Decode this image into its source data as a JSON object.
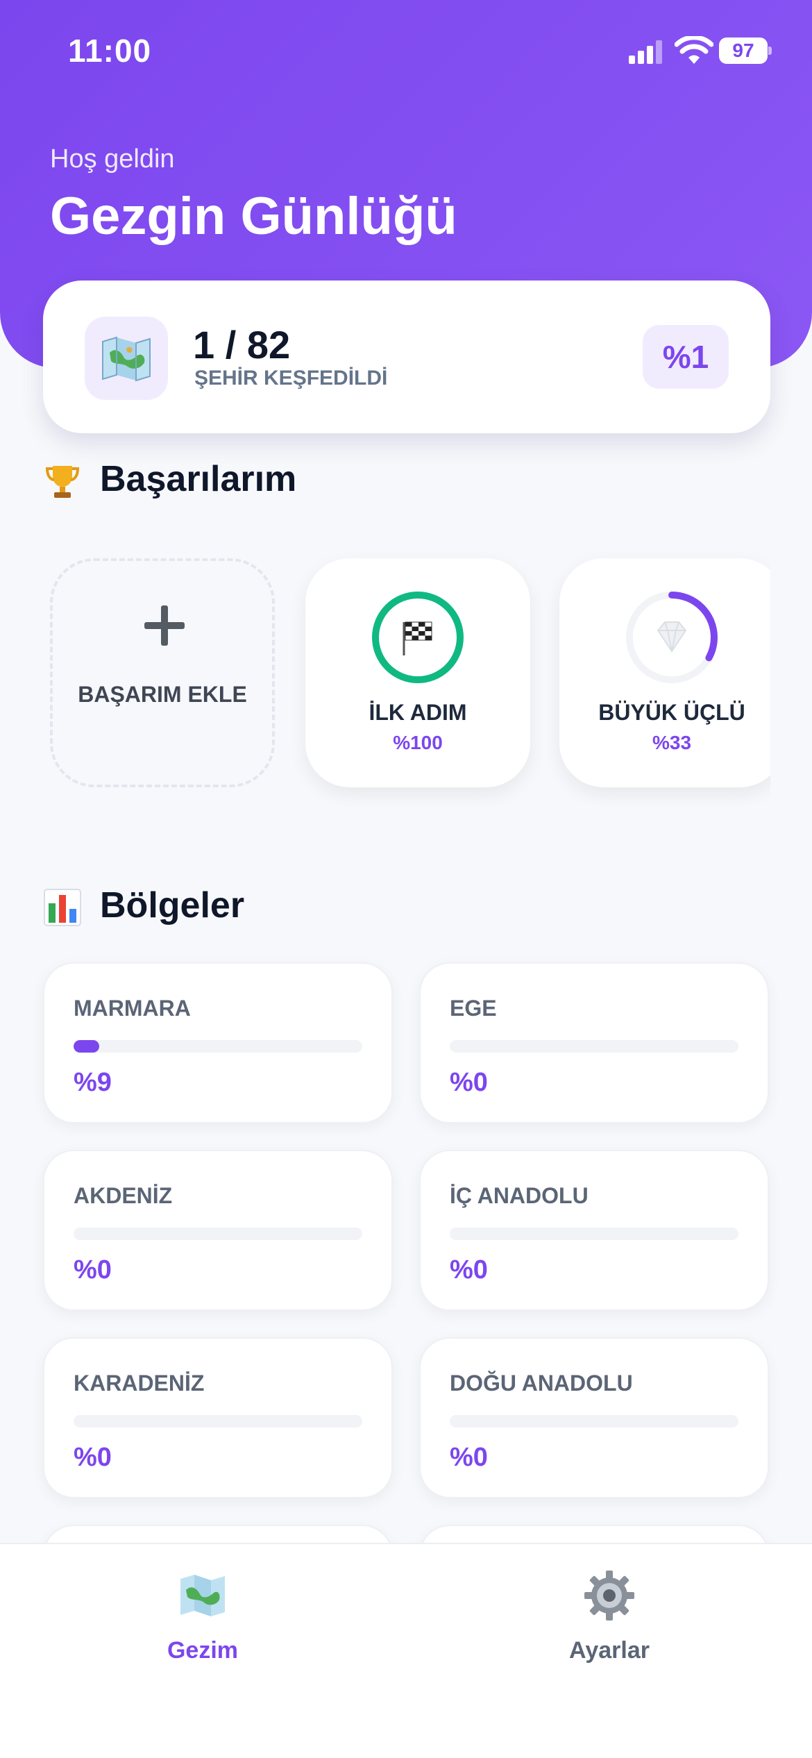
{
  "status_bar": {
    "time": "11:00",
    "battery": "97"
  },
  "header": {
    "greeting": "Hoş geldin",
    "title": "Gezgin Günlüğü"
  },
  "progress": {
    "count": "1 / 82",
    "caption": "ŞEHİR KEŞFEDİLDİ",
    "percent": "%1"
  },
  "achievements": {
    "title": "Başarılarım",
    "add_label": "BAŞARIM EKLE",
    "items": [
      {
        "name": "İLK ADIM",
        "percent_label": "%100",
        "progress": 1.0
      },
      {
        "name": "BÜYÜK ÜÇLÜ",
        "percent_label": "%33",
        "progress": 0.33
      }
    ]
  },
  "regions": {
    "title": "Bölgeler",
    "items": [
      {
        "name": "MARMARA",
        "percent_label": "%9",
        "progress": 0.09
      },
      {
        "name": "EGE",
        "percent_label": "%0",
        "progress": 0
      },
      {
        "name": "AKDENİZ",
        "percent_label": "%0",
        "progress": 0
      },
      {
        "name": "İÇ ANADOLU",
        "percent_label": "%0",
        "progress": 0
      },
      {
        "name": "KARADENİZ",
        "percent_label": "%0",
        "progress": 0
      },
      {
        "name": "DOĞU ANADOLU",
        "percent_label": "%0",
        "progress": 0
      }
    ]
  },
  "tabbar": {
    "items": [
      {
        "label": "Gezim",
        "icon": "map-icon",
        "active": true
      },
      {
        "label": "Ayarlar",
        "icon": "gear-icon",
        "active": false
      }
    ]
  },
  "colors": {
    "accent": "#7c46ee",
    "ring_green": "#10b981",
    "muted": "#64748b"
  }
}
